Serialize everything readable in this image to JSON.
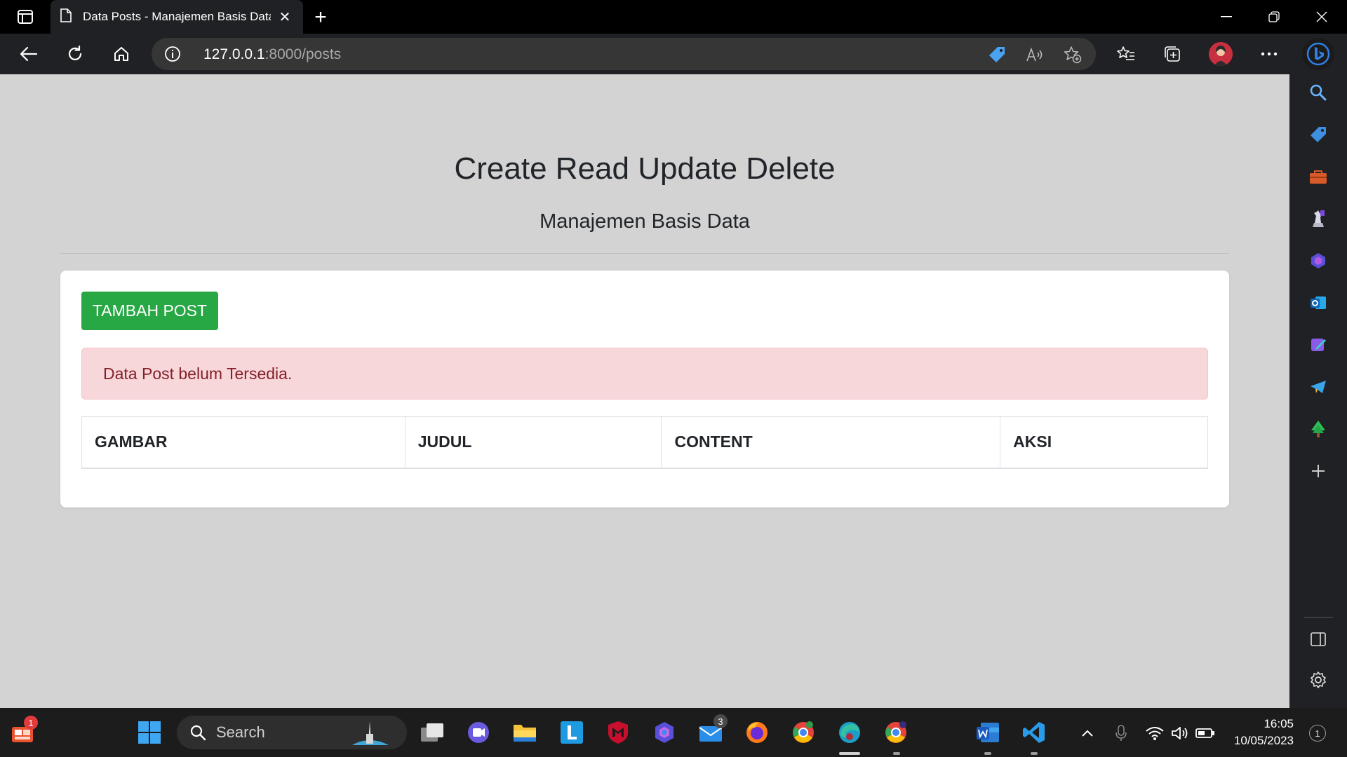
{
  "browser": {
    "tab_title": "Data Posts - Manajemen Basis Data",
    "url_host": "127.0.0.1",
    "url_path": ":8000/posts"
  },
  "page": {
    "title": "Create Read Update Delete",
    "subtitle": "Manajemen Basis Data",
    "add_button": "TAMBAH POST",
    "alert": "Data Post belum Tersedia.",
    "table_headers": [
      "GAMBAR",
      "JUDUL",
      "CONTENT",
      "AKSI"
    ]
  },
  "sidebar": {
    "items": [
      "search-icon",
      "shopping-tag-icon",
      "tools-icon",
      "games-icon",
      "copilot-icon",
      "outlook-icon",
      "drop-icon",
      "telegram-icon",
      "tree-icon",
      "add-icon"
    ]
  },
  "taskbar": {
    "search_label": "Search",
    "widgets_badge": "1",
    "mail_badge": "3",
    "time": "16:05",
    "date": "10/05/2023",
    "notification_count": "1"
  },
  "colors": {
    "success": "#28a745",
    "alert_bg": "#f8d7da",
    "alert_text": "#842029",
    "page_bg": "#d3d3d3"
  }
}
